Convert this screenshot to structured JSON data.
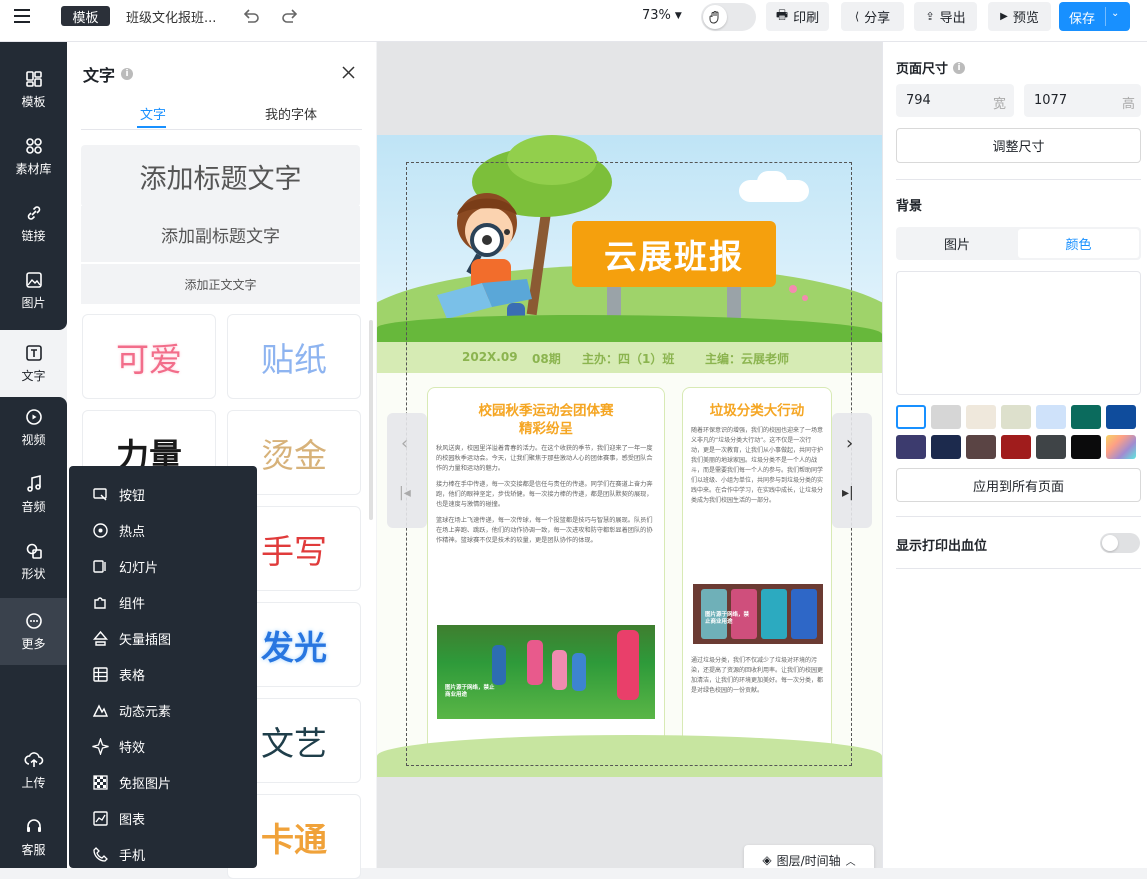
{
  "topbar": {
    "template_tag": "模板",
    "doc_title": "班级文化报班...",
    "zoom": "73%",
    "print": "印刷",
    "share": "分享",
    "export": "导出",
    "preview": "预览",
    "save": "保存"
  },
  "nav": {
    "items": [
      "模板",
      "素材库",
      "链接",
      "图片",
      "文字",
      "视频",
      "音频",
      "形状",
      "更多"
    ],
    "upload": "上传",
    "service": "客服"
  },
  "panel": {
    "title": "文字",
    "tabs": [
      "文字",
      "我的字体"
    ],
    "add_title": "添加标题文字",
    "add_subtitle": "添加副标题文字",
    "add_body": "添加正文文字",
    "styles": [
      "可爱",
      "贴纸",
      "力量",
      "烫金",
      "手写",
      "发光",
      "文艺",
      "卡通"
    ]
  },
  "more_menu": {
    "items": [
      "按钮",
      "热点",
      "幻灯片",
      "组件",
      "矢量插图",
      "表格",
      "动态元素",
      "特效",
      "免抠图片",
      "图表",
      "手机"
    ]
  },
  "canvas": {
    "banner_title": "云展班报",
    "info": {
      "date": "202X.09",
      "issue": "08期",
      "host": "主办：四（1）班",
      "editor": "主编：云展老师"
    },
    "left": {
      "title1": "校园秋季运动会团体赛",
      "title2": "精彩纷呈",
      "p1": "秋风送爽，校园里洋溢着青春的活力。在这个收获的季节，我们迎来了一年一度的校园秋季运动会。今天，让我们聚焦于那些激动人心的团体赛事，感受团队合作的力量和运动的魅力。",
      "p2": "接力棒在手中传递，每一次交接都是信任与责任的传递。同学们在赛道上奋力奔跑，他们的眼神坚定，步伐矫健。每一次接力棒的传递，都是团队默契的展现，也是速度与激情的碰撞。",
      "p3": "篮球在场上飞速传递，每一次传球，每一个投篮都是技巧与智慧的展现。队员们在场上奔跑、跳跃，他们的动作协调一致，每一次进攻和防守都彰显着团队的协作精神。篮球赛不仅是技术的较量，更是团队协作的体现。",
      "photo_caption": "图片源于网络，禁止商业用途"
    },
    "right": {
      "title": "垃圾分类大行动",
      "p1": "随着环保意识的增强，我们的校园也迎来了一场意义非凡的“垃圾分类大行动”。这不仅是一次行动，更是一次教育，让我们从小事做起，共同守护我们美丽的地球家园。垃圾分类不是一个人的战斗，而是需要我们每一个人的参与。我们帮助同学们以班级、小组为单位，共同参与到垃圾分类的实践中来。在合作中学习，在实践中成长，让垃圾分类成为我们校园生活的一部分。",
      "photo_caption": "图片源于网络，禁止商业用途",
      "p2": "通过垃圾分类，我们不仅减少了垃圾对环境的污染，还提高了资源的回收利用率。让我们的校园更加清洁，让我们的环境更加美好。每一次分类，都是对绿色校园的一份贡献。"
    },
    "layers_button": "图层/时间轴"
  },
  "right_panel": {
    "page_size": "页面尺寸",
    "width": "794",
    "width_unit": "宽",
    "height": "1077",
    "height_unit": "高",
    "resize": "调整尺寸",
    "background": "背景",
    "bg_tabs": [
      "图片",
      "颜色"
    ],
    "apply_all": "应用到所有页面",
    "bleed": "显示打印出血位",
    "swatches": [
      "#ffffff",
      "#d6d6d6",
      "#efe8dc",
      "#dde0cc",
      "#cfe2fa",
      "#0b6b5d",
      "#0f4c9c",
      "#3c3b6e",
      "#1c2a4d",
      "#5a4444",
      "#a01c1c",
      "#3f4447",
      "#0b0b0c",
      "gradient"
    ],
    "accent": "#1890ff"
  }
}
